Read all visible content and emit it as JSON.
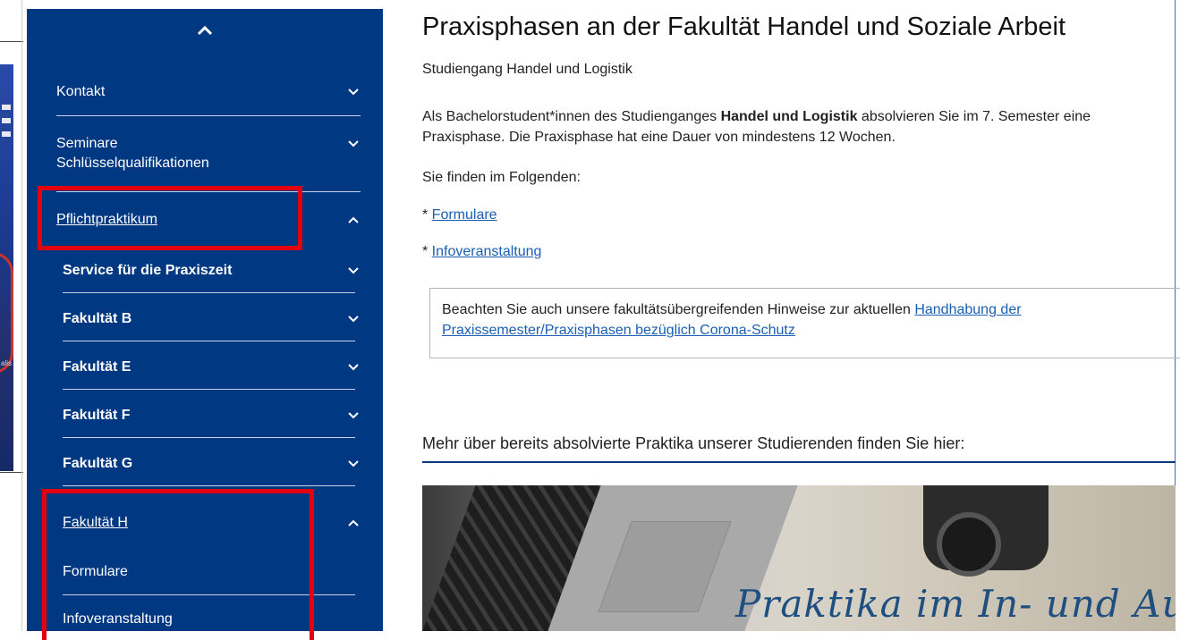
{
  "colors": {
    "sidebar_bg": "#003882",
    "highlight": "#e3000f",
    "link": "#1a5fb4"
  },
  "sidebar": {
    "top_button_icon": "chevron-up-icon",
    "items": [
      {
        "label": "Kontakt",
        "chevron": "chevron-down-icon"
      },
      {
        "label": "Seminare\nSchlüsselqualifikationen",
        "chevron": "chevron-down-icon"
      },
      {
        "label": "Pflichtpraktikum",
        "chevron": "chevron-up-icon",
        "highlighted": true
      },
      {
        "label": "Service für die Praxiszeit",
        "chevron": "chevron-down-icon"
      },
      {
        "label": "Fakultät B",
        "chevron": "chevron-down-icon"
      },
      {
        "label": "Fakultät E",
        "chevron": "chevron-down-icon"
      },
      {
        "label": "Fakultät F",
        "chevron": "chevron-down-icon"
      },
      {
        "label": "Fakultät G",
        "chevron": "chevron-down-icon"
      },
      {
        "label": "Fakultät H",
        "chevron": "chevron-up-icon",
        "highlighted": true
      },
      {
        "label": "Formulare"
      },
      {
        "label": "Infoveranstaltung"
      }
    ]
  },
  "main": {
    "title": "Praxisphasen an der Fakultät Handel und Soziale Arbeit",
    "subtitle": "Studiengang Handel und Logistik",
    "intro_before": "Als Bachelorstudent*innen des Studienganges ",
    "intro_bold": "Handel und Logistik",
    "intro_after": " absolvieren Sie im 7. Semester eine Praxisphase. Die Praxisphase hat eine Dauer von mindestens 12 Wochen.",
    "following": "Sie finden im Folgenden:",
    "bullet_prefix": "* ",
    "links": [
      "Formulare",
      "Infoveranstaltung"
    ],
    "notice_text": "Beachten Sie auch unsere fakultätsübergreifenden Hinweise zur aktuellen ",
    "notice_link": "Handhabung der Praxissemester/Praxisphasen bezüglich Corona-Schutz",
    "more_heading": "Mehr über bereits absolvierte Praktika unserer Studierenden finden Sie hier:",
    "photo_caption": "Praktika im In- und Ausland"
  }
}
